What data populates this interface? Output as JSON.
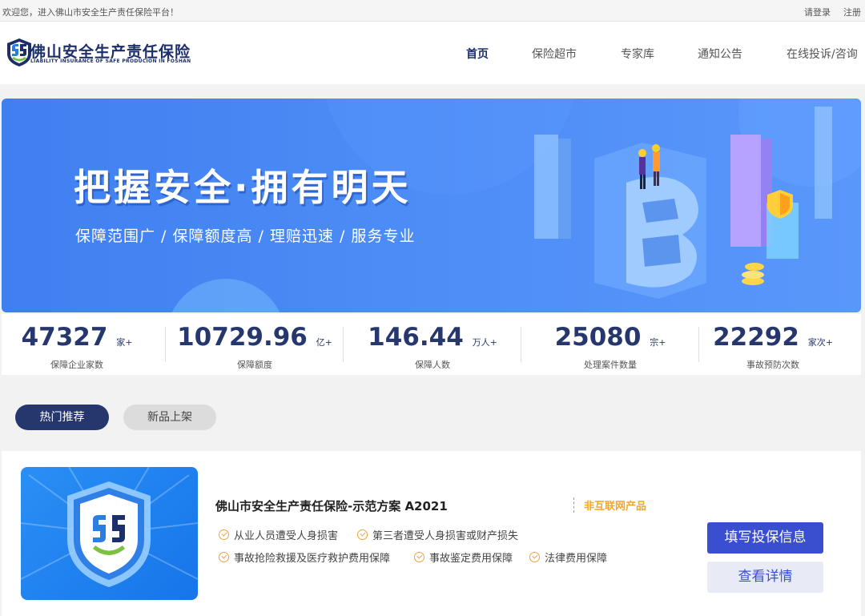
{
  "topbar": {
    "welcome": "欢迎您，进入佛山市安全生产责任保险平台！",
    "login": "请登录",
    "register": "注册"
  },
  "header": {
    "brand_cn": "佛山安全生产责任保险",
    "brand_en": "LIABILITY INSURANCE OF SAFE PRODUCION IN FOSHAN",
    "nav": [
      {
        "label": "首页",
        "active": true
      },
      {
        "label": "保险超市",
        "active": false
      },
      {
        "label": "专家库",
        "active": false
      },
      {
        "label": "通知公告",
        "active": false
      },
      {
        "label": "在线投诉/咨询",
        "active": false
      }
    ]
  },
  "banner": {
    "title": "把握安全·拥有明天",
    "subtitle": "保障范围广 / 保障额度高 / 理赔迅速 / 服务专业"
  },
  "stats": [
    {
      "value": "47327",
      "unit": "家+",
      "label": "保障企业家数"
    },
    {
      "value": "10729.96",
      "unit": "亿+",
      "label": "保障额度"
    },
    {
      "value": "146.44",
      "unit": "万人+",
      "label": "保障人数"
    },
    {
      "value": "25080",
      "unit": "宗+",
      "label": "处理案件数量"
    },
    {
      "value": "22292",
      "unit": "家次+",
      "label": "事故预防次数"
    }
  ],
  "tabs": {
    "hot": "热门推荐",
    "new": "新品上架"
  },
  "product": {
    "title": "佛山市安全生产责任保险-示范方案 A2021",
    "tag": "非互联网产品",
    "features_row1": [
      "从业人员遭受人身损害",
      "第三者遭受人身损害或财产损失"
    ],
    "features_row2": [
      "事故抢险救援及医疗救护费用保障",
      "事故鉴定费用保障",
      "法律费用保障"
    ],
    "fill_button": "填写投保信息",
    "detail_button": "查看详情"
  },
  "colors": {
    "brand_navy": "#26376e",
    "primary_button": "#3a4fcf",
    "tag_orange": "#f5a623",
    "banner_blue": "#4c8cf6"
  }
}
